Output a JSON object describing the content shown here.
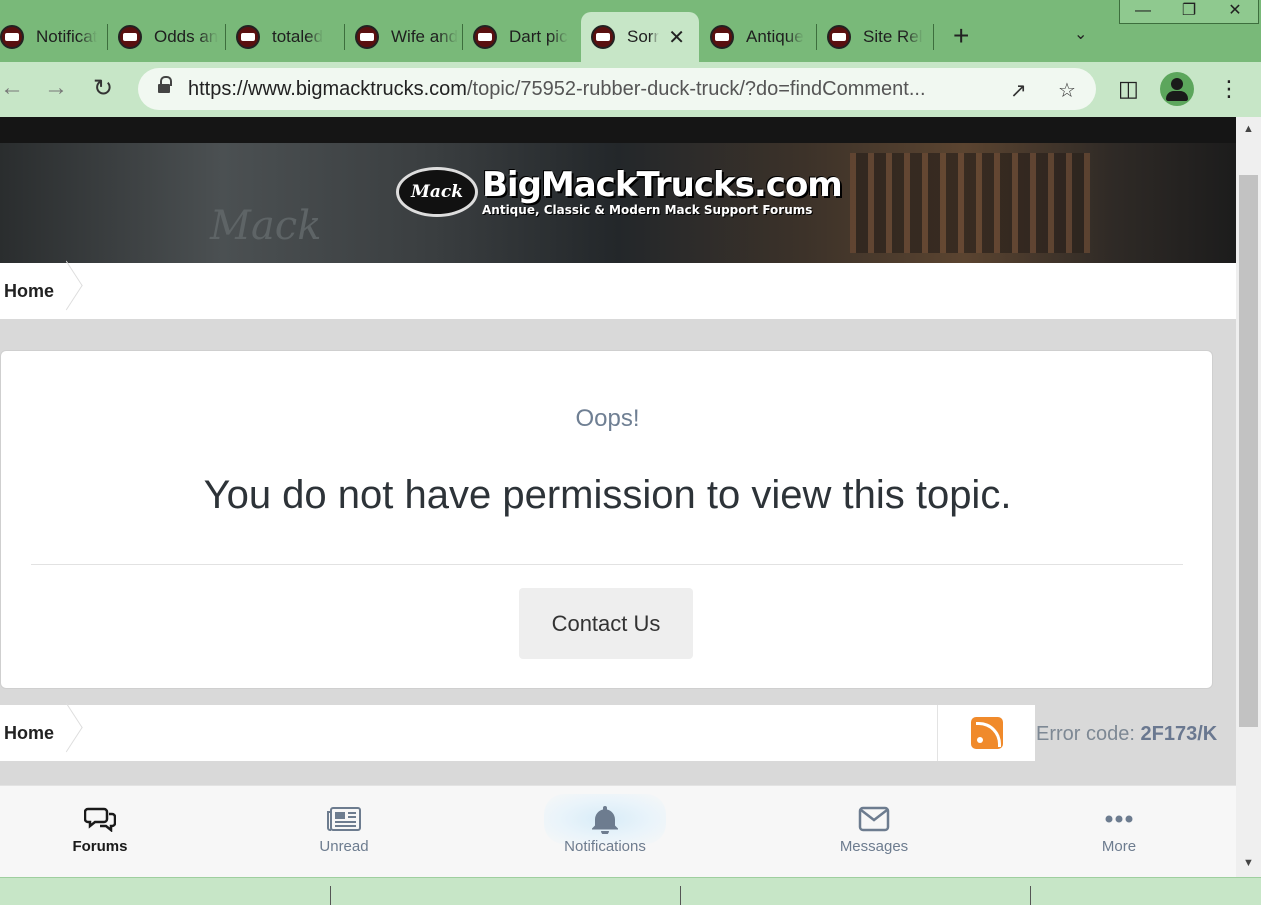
{
  "browser": {
    "tabs": [
      {
        "title": "Notificat"
      },
      {
        "title": "Odds an"
      },
      {
        "title": "totaled"
      },
      {
        "title": "Wife and"
      },
      {
        "title": "Dart pic"
      },
      {
        "title": "Sorr",
        "active": true
      },
      {
        "title": "Antique"
      },
      {
        "title": "Site Rel"
      }
    ],
    "url_host": "https://www.bigmacktrucks.com",
    "url_path": "/topic/75952-rubber-duck-truck/?do=findComment..."
  },
  "site": {
    "logo_badge": "Mack",
    "logo_title": "BigMackTrucks.com",
    "logo_subtitle": "Antique, Classic & Modern Mack Support Forums",
    "banner_watermark": "Mack"
  },
  "breadcrumb": {
    "home": "Home"
  },
  "error": {
    "oops": "Oops!",
    "message": "You do not have permission to view this topic.",
    "contact_label": "Contact Us",
    "code_label": "Error code:",
    "code": "2F173/K"
  },
  "footer_nav": {
    "items": [
      {
        "label": "Forums",
        "icon": "chat-bubbles-icon"
      },
      {
        "label": "Unread",
        "icon": "newspaper-icon"
      },
      {
        "label": "Notifications",
        "icon": "bell-icon"
      },
      {
        "label": "Messages",
        "icon": "envelope-icon"
      },
      {
        "label": "More",
        "icon": "ellipsis-icon"
      }
    ]
  },
  "colors": {
    "browser_frame": "#79b979",
    "toolbar": "#c7e6c7",
    "rss": "#f08a2b",
    "error_code": "#6a7890"
  }
}
